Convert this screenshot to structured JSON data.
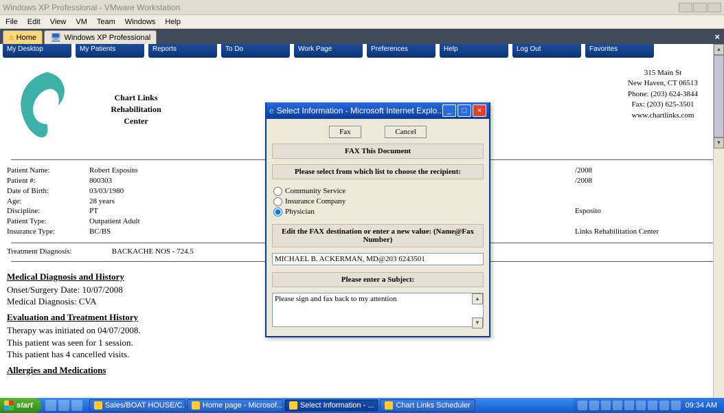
{
  "vmware": {
    "title": "Windows XP Professional - VMware Workstation",
    "menu": [
      "File",
      "Edit",
      "View",
      "VM",
      "Team",
      "Windows",
      "Help"
    ],
    "tab_home": "Home",
    "tab_xp": "Windows XP Professional"
  },
  "topnav": [
    "My Desktop",
    "My Patients",
    "Reports",
    "To Do",
    "Work Page",
    "Preferences",
    "Help",
    "Log Out",
    "Favorites"
  ],
  "center": {
    "l1": "Chart Links",
    "l2": "Rehabilitation",
    "l3": "Center"
  },
  "contact": {
    "addr1": "315 Main St",
    "addr2": "New Haven, CT 06513",
    "phone": "Phone: (203) 624-3844",
    "fax": "Fax: (203) 625-3501",
    "web": "www.chartlinks.com"
  },
  "patient": {
    "name_l": "Patient Name:",
    "name_v": "Robert Esposito",
    "num_l": "Patient #:",
    "num_v": "800303",
    "dob_l": "Date of Birth:",
    "dob_v": "03/03/1980",
    "age_l": "Age:",
    "age_v": "28 years",
    "disc_l": "Discipline:",
    "disc_v": "PT",
    "ptype_l": "Patient Type:",
    "ptype_v": "Outpatient Adult",
    "ins_l": "Insurance Type:",
    "ins_v": "BC/BS",
    "right_date1": "/2008",
    "right_date2": "/2008",
    "right_name": "Esposito",
    "right_center": "Links Rehabilitation Center"
  },
  "diagnosis": {
    "lab": "Treatment Diagnosis:",
    "val": "BACKACHE NOS - 724.5"
  },
  "sections": {
    "mdh_h": "Medical Diagnosis and History",
    "mdh_1": "Onset/Surgery Date: 10/07/2008",
    "mdh_2": "Medical Diagnosis: CVA",
    "eth_h": "Evaluation and Treatment History",
    "eth_1": "Therapy was initiated on 04/07/2008.",
    "eth_2": "This patient was seen for 1 session.",
    "eth_3": "This patient has 4 cancelled visits.",
    "am_h": "Allergies and Medications"
  },
  "modal": {
    "title": "Select Information - Microsoft Internet Explo...",
    "btn_fax": "Fax",
    "btn_cancel": "Cancel",
    "h1": "FAX This Document",
    "h2": "Please select from which list to choose the recipient:",
    "r1": "Community Service",
    "r2": "Insurance Company",
    "r3": "Physician",
    "h3": "Edit the FAX destination or enter a new value: (Name@Fax Number)",
    "dest": "MICHAEL B. ACKERMAN, MD@203 6243501",
    "h4": "Please enter a Subject:",
    "subject": "Please sign and fax back to my attention"
  },
  "taskbar": {
    "start": "start",
    "t1": "Sales/BOAT HOUSE/C...",
    "t2": "Home page - Microsof...",
    "t3": "Select Information - ...",
    "t4": "Chart Links Scheduler",
    "clock": "09:34 AM"
  }
}
